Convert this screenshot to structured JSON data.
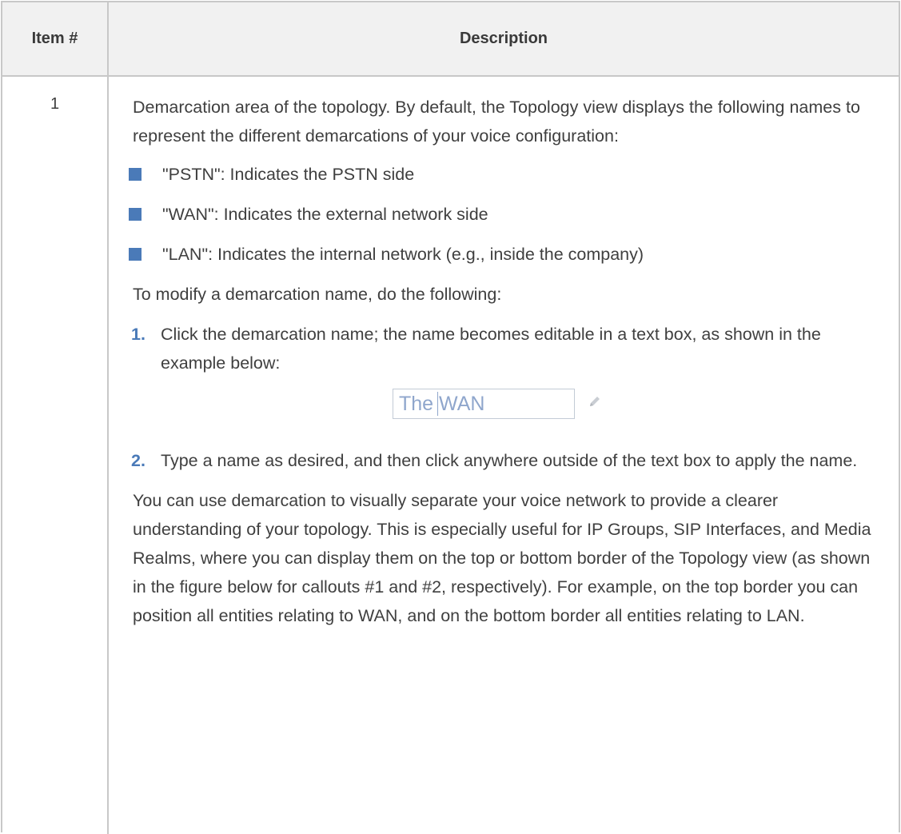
{
  "table": {
    "headers": {
      "item": "Item #",
      "description": "Description"
    },
    "rows": [
      {
        "item": "1",
        "intro": "Demarcation area of the topology. By default, the Topology view displays the following names to represent the different demarcations of your voice configuration:",
        "bullets": [
          "\"PSTN\": Indicates the PSTN side",
          "\"WAN\": Indicates the external network side",
          "\"LAN\": Indicates the internal network (e.g., inside the company)"
        ],
        "todo": "To modify a demarcation name, do the following:",
        "steps": [
          {
            "num": "1.",
            "text": "Click the demarcation name; the name becomes editable in a text box, as shown in the example below:"
          },
          {
            "num": "2.",
            "text": "Type a name as desired, and then click anywhere outside of the text box to apply the name."
          }
        ],
        "example": {
          "part1": "The",
          "part2": "WAN",
          "icon": "pencil-icon"
        },
        "closing": "You can use demarcation to visually separate your voice network to provide a clearer understanding of your topology. This is especially useful for IP Groups, SIP Interfaces, and Media Realms, where you can display them on the top or bottom border of the Topology view (as shown in the figure below for callouts #1 and #2, respectively). For example, on the top border you can position all entities relating to WAN, and on the bottom border all entities relating to LAN."
      }
    ]
  },
  "colors": {
    "accent": "#4a7ab8",
    "header_bg": "#f1f1f1",
    "border": "#c8c8c8",
    "text": "#3f3f3f",
    "example_text": "#8fa6cc"
  }
}
